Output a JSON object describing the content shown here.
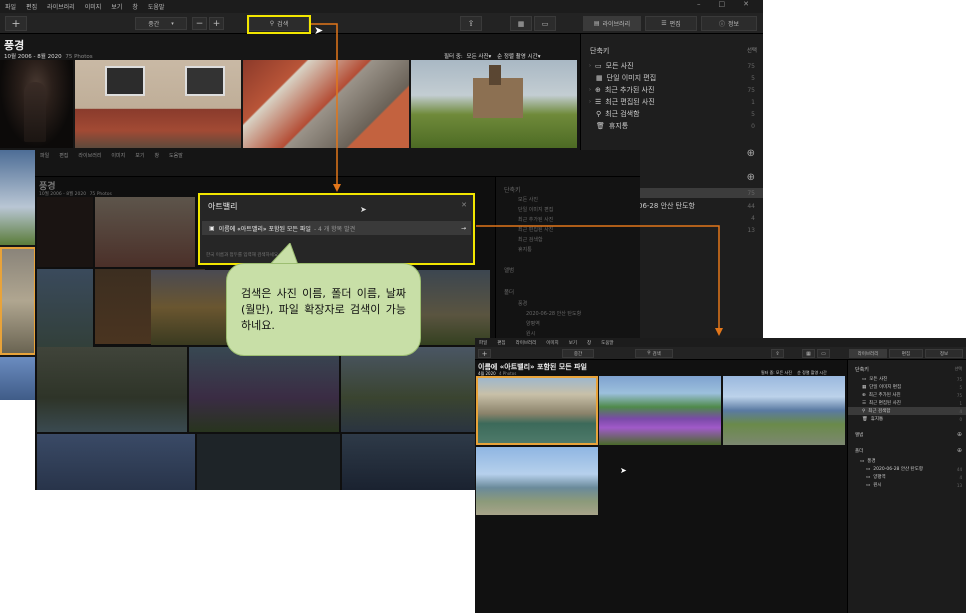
{
  "menu": [
    "파일",
    "편집",
    "라이브러리",
    "이미지",
    "보기",
    "창",
    "도움말"
  ],
  "window_controls": [
    "–",
    "□",
    "✕"
  ],
  "toolbar": {
    "add": "+",
    "sort": "중간",
    "zoom_out": "−",
    "zoom_in": "+",
    "search": "검색",
    "tab_library": "라이브러리",
    "tab_edit": "편집",
    "tab_info": "정보"
  },
  "album": {
    "title": "풍경",
    "dates": "10월 2006 - 8월 2020",
    "count": "75 Photos",
    "filter_label": "필터 중:",
    "filter_value": "모든 사진",
    "sort_value": "순 정렬 촬영 시간"
  },
  "sidebar": {
    "header": "단축키",
    "select": "선택",
    "items": [
      {
        "label": "모든 사진",
        "count": "75"
      },
      {
        "label": "단일 이미지 편집",
        "count": "5"
      },
      {
        "label": "최근 추가된 사진",
        "count": "75"
      },
      {
        "label": "최근 편집된 사진",
        "count": "1"
      },
      {
        "label": "최근 검색함",
        "count": "5"
      },
      {
        "label": "휴지통",
        "count": "0"
      }
    ],
    "peek": [
      {
        "label": "06-28 안산 탄도항",
        "count": "44"
      },
      {
        "count": "4"
      },
      {
        "count": "13"
      },
      {
        "count": "75"
      }
    ]
  },
  "mid": {
    "menu": [
      "파일",
      "편집",
      "라이브러리",
      "이미지",
      "보기",
      "창",
      "도움말"
    ],
    "title": "풍경",
    "dates": "10월 2006 - 8월 2020",
    "count": "75 Photos",
    "sidebar": {
      "header": "단축키",
      "items": [
        "모든 사진",
        "단일 이미지 편집",
        "최근 추가된 사진",
        "최근 편집된 사진",
        "최근 검색함",
        "휴지통"
      ],
      "albums": "앨범",
      "folders": "폴더",
      "folder_root": "풍경",
      "folder_items": [
        "2020-06-28 안산 탄도항",
        "양평역",
        "원시"
      ]
    }
  },
  "search_popup": {
    "query": "아트밸리",
    "result": "이름에 «아트밸리» 포함된 모든 파일",
    "result_count": "- 4 개 항목 발견",
    "hint": "한국 이름과 접두를 입력해 검색하세요"
  },
  "callout": "검색은 사진 이름, 폴더 이름, 날짜(월만), 파일 확장자로 검색이 가능하네요.",
  "result": {
    "menu": [
      "파일",
      "편집",
      "라이브러리",
      "이미지",
      "보기",
      "창",
      "도움말"
    ],
    "title": "이름에 «아트밸리» 포함된 모든 파일",
    "dates": "4월 2020",
    "count": "4 Photos",
    "filter": "필터 중: 모든 사진",
    "sort": "순 정렬 촬영 시간",
    "sort_select": "중간",
    "search": "검색",
    "tabs": [
      "라이브러리",
      "편집",
      "정보"
    ],
    "sidebar": {
      "header": "단축키",
      "select": "선택",
      "items": [
        {
          "label": "모든 사진",
          "count": "75"
        },
        {
          "label": "단일 이미지 편집",
          "count": "5"
        },
        {
          "label": "최근 추가된 사진",
          "count": "75"
        },
        {
          "label": "최근 편집된 사진",
          "count": "1"
        },
        {
          "label": "최근 검색함",
          "count": "4"
        },
        {
          "label": "휴지통",
          "count": "0"
        }
      ],
      "albums": "앨범",
      "folders": "폴더",
      "folder_root": "풍경",
      "folder_items": [
        {
          "label": "2020-06-28 안산 탄도항",
          "count": "44"
        },
        {
          "label": "양평역",
          "count": "4"
        },
        {
          "label": "원시",
          "count": "13"
        }
      ]
    }
  },
  "colors": {
    "highlight": "#f2e600",
    "arrow": "#e2761a",
    "callout_bg": "#c8dfa7",
    "callout_border": "#9dbe72",
    "accent": "#e8a33a"
  }
}
